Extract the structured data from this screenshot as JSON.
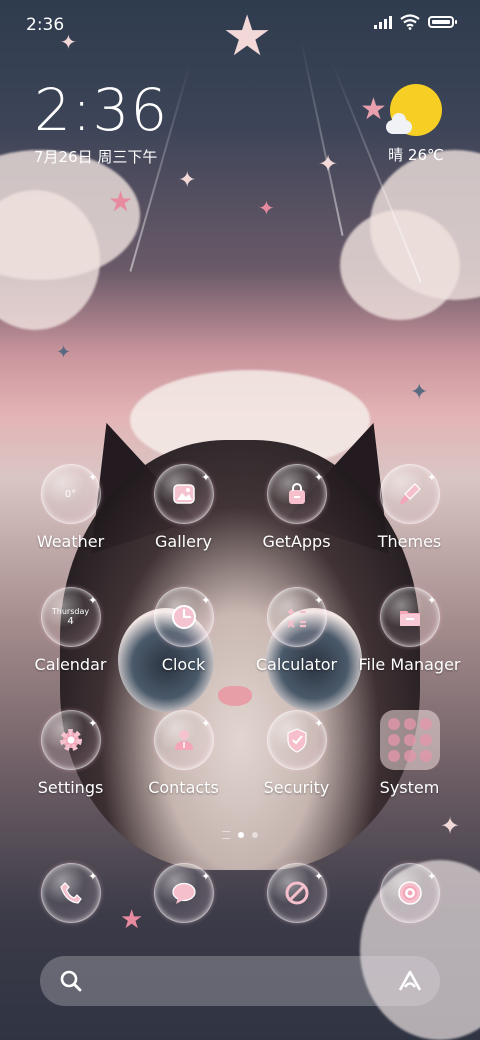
{
  "status_bar": {
    "time": "2:36",
    "signal_icon": "signal-icon",
    "wifi_icon": "wifi-icon",
    "battery_icon": "battery-icon"
  },
  "clock_widget": {
    "time": "2:36",
    "date": "7月26日 周三下午"
  },
  "weather_widget": {
    "icon": "sun-cloud-icon",
    "text": "晴 26℃"
  },
  "apps": [
    {
      "label": "Weather",
      "icon": "weather-icon",
      "badge": "0°"
    },
    {
      "label": "Gallery",
      "icon": "gallery-icon"
    },
    {
      "label": "GetApps",
      "icon": "shopping-bag-icon"
    },
    {
      "label": "Themes",
      "icon": "brush-icon"
    },
    {
      "label": "Calendar",
      "icon": "calendar-icon",
      "day_name": "Thursday",
      "day_num": "4"
    },
    {
      "label": "Clock",
      "icon": "clock-icon"
    },
    {
      "label": "Calculator",
      "icon": "calculator-icon"
    },
    {
      "label": "File Manager",
      "icon": "folder-icon"
    },
    {
      "label": "Settings",
      "icon": "gear-icon"
    },
    {
      "label": "Contacts",
      "icon": "person-icon"
    },
    {
      "label": "Security",
      "icon": "shield-icon"
    },
    {
      "label": "System",
      "icon": "folder-grid-icon"
    }
  ],
  "dock": [
    {
      "icon": "phone-icon"
    },
    {
      "icon": "message-icon"
    },
    {
      "icon": "browser-icon"
    },
    {
      "icon": "camera-icon"
    }
  ],
  "pager": {
    "current_page": 1,
    "page_count": 2
  },
  "search_bar": {
    "search_icon": "search-icon",
    "assistant_icon": "assistant-icon"
  },
  "colors": {
    "accent_pink": "#f7c8d4",
    "sun": "#f7cf24"
  }
}
